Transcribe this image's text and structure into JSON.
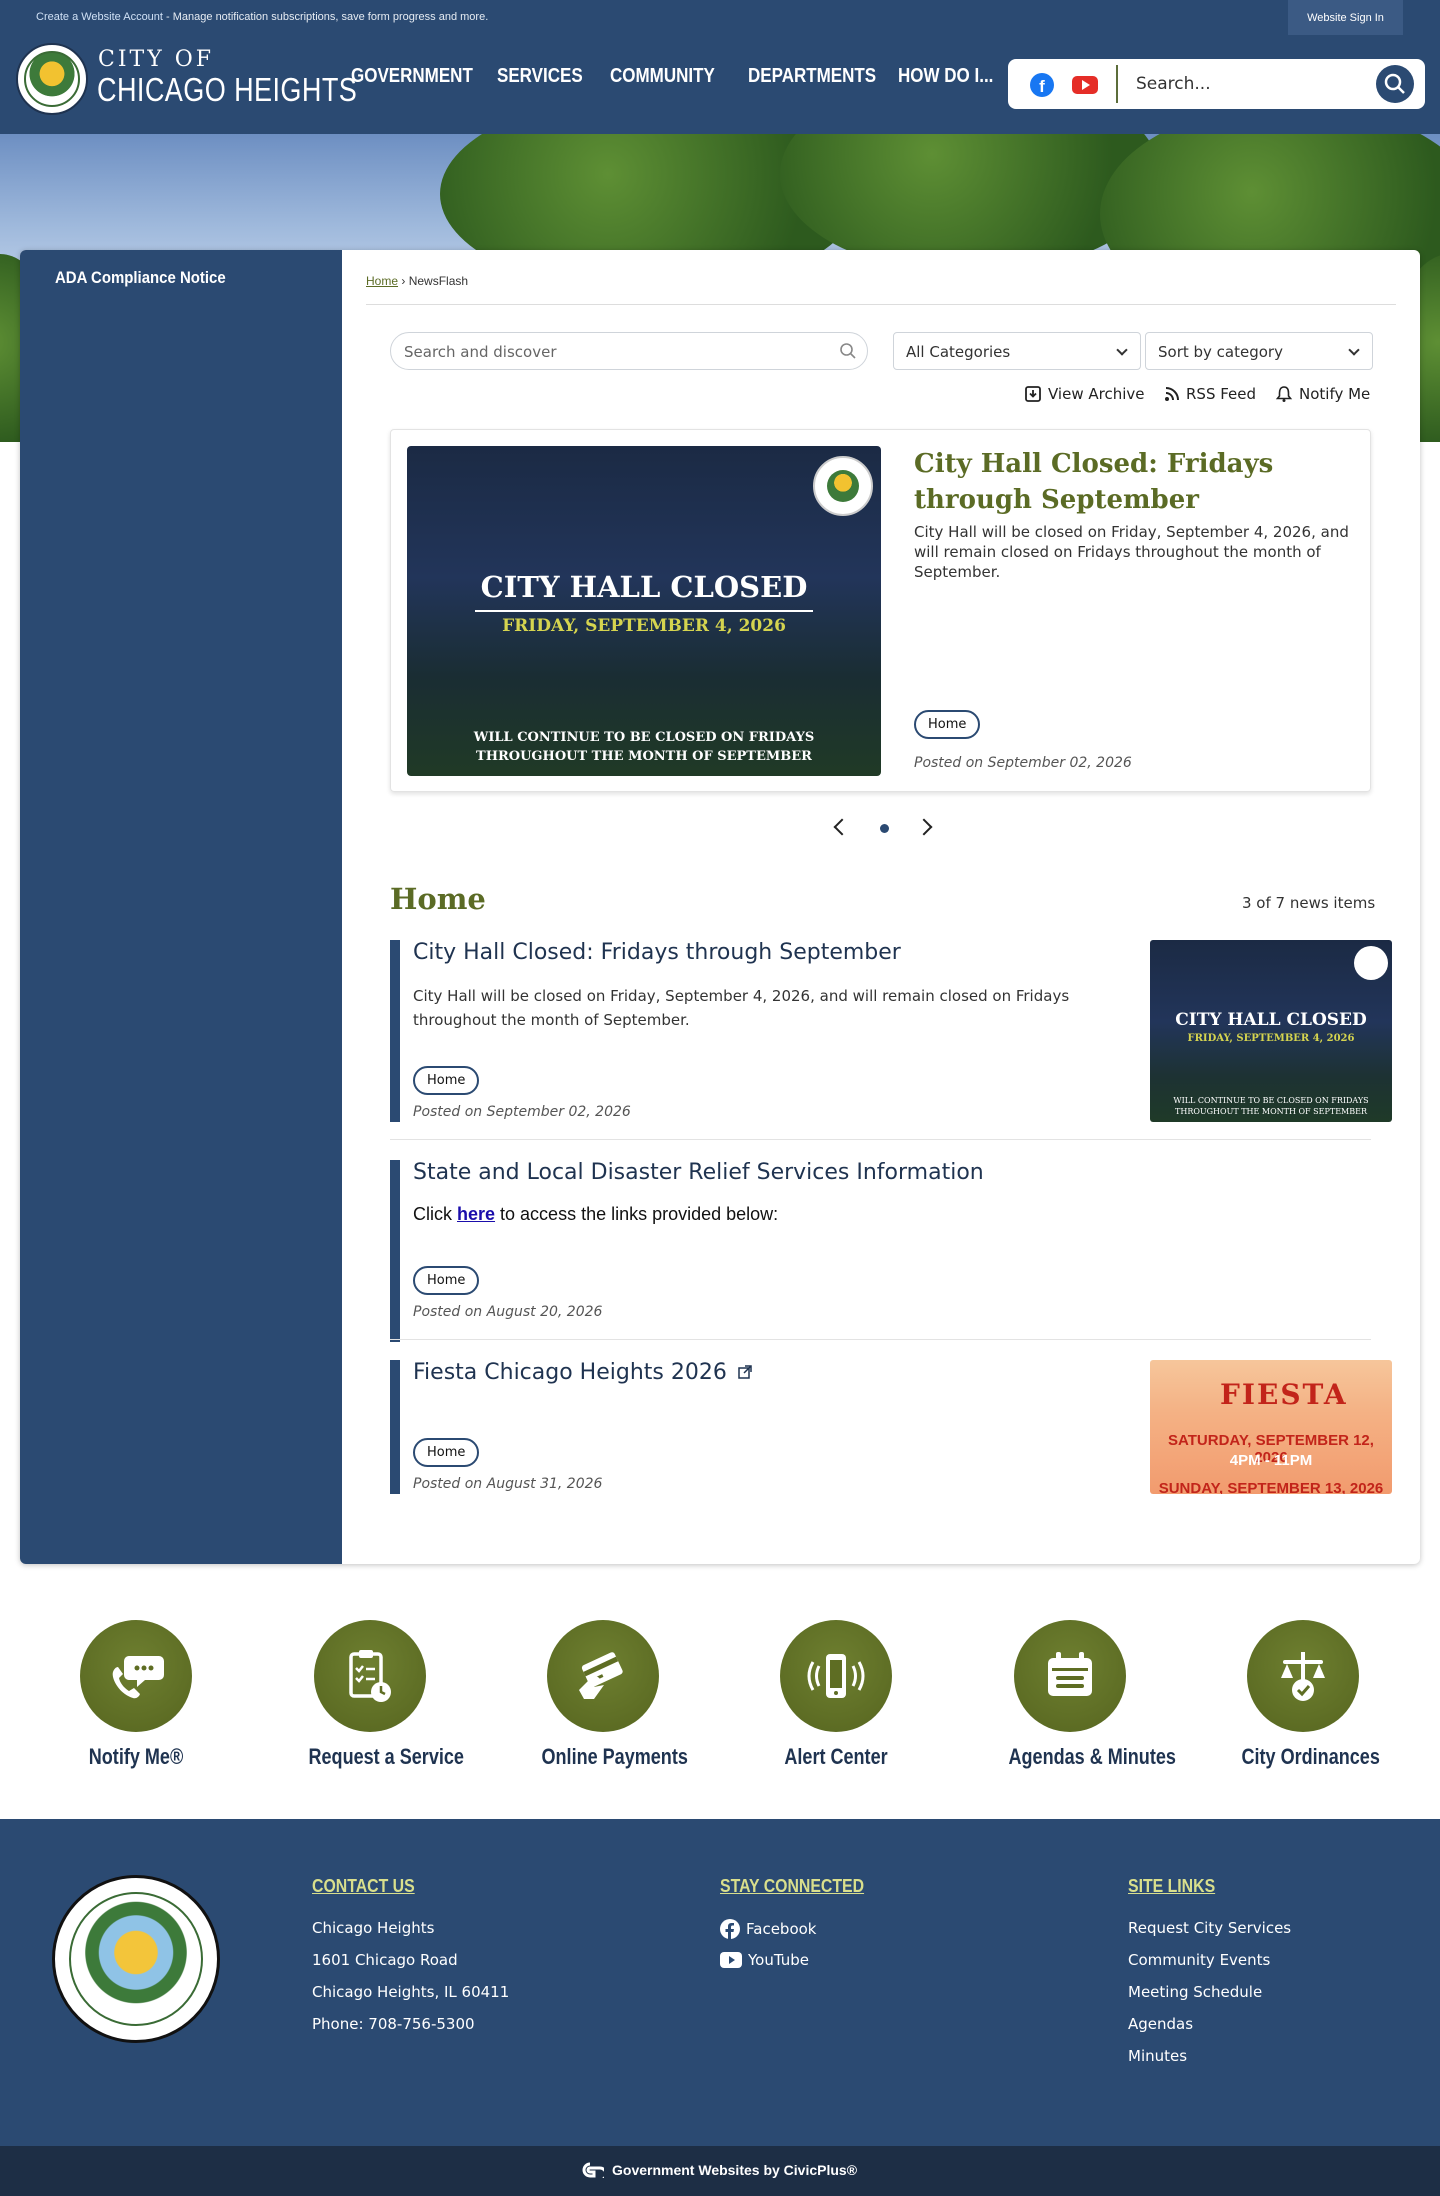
{
  "topbar": {
    "link": "Create a Website Account",
    "message": " - Manage notification subscriptions, save form progress and more.",
    "sign_in": "Website Sign In"
  },
  "header": {
    "logo_line1": "CITY OF",
    "logo_line2": "CHICAGO HEIGHTS",
    "nav": [
      "GOVERNMENT",
      "SERVICES",
      "COMMUNITY",
      "DEPARTMENTS",
      "HOW DO I..."
    ],
    "search_placeholder": "Search...",
    "icons": [
      "facebook-icon",
      "youtube-icon",
      "search-icon"
    ]
  },
  "sidebar": {
    "items": [
      {
        "label": "ADA Compliance Notice"
      }
    ]
  },
  "breadcrumb": {
    "home": "Home",
    "sep": " › ",
    "current": "NewsFlash"
  },
  "filters": {
    "search_placeholder": "Search and discover",
    "category": "All Categories",
    "sort": "Sort by category"
  },
  "tools": {
    "archive": "View Archive",
    "rss": "RSS Feed",
    "notify": "Notify Me"
  },
  "featured": {
    "image_title": "CITY HALL CLOSED",
    "image_date": "FRIDAY, SEPTEMBER 4, 2026",
    "image_foot1": "WILL CONTINUE TO BE CLOSED ON FRIDAYS",
    "image_foot2": "THROUGHOUT THE MONTH OF SEPTEMBER",
    "title": "City Hall Closed: Fridays through September",
    "description": "City Hall will be closed on Friday, September 4, 2026, and will remain closed on Fridays throughout the month of September.",
    "tag": "Home",
    "posted": "Posted on September 02, 2026"
  },
  "section": {
    "title": "Home",
    "count": "3 of 7 news items"
  },
  "items": [
    {
      "title": "City Hall Closed: Fridays through September",
      "description": "City Hall will be closed on Friday, September 4, 2026, and will remain closed on Fridays throughout the month of September.",
      "tag": "Home",
      "posted": "Posted on September 02, 2026",
      "thumb_title": "CITY HALL CLOSED",
      "thumb_date": "FRIDAY, SEPTEMBER 4, 2026",
      "thumb_foot1": "WILL CONTINUE TO BE CLOSED ON FRIDAYS",
      "thumb_foot2": "THROUGHOUT THE MONTH OF SEPTEMBER"
    },
    {
      "title": "State and Local Disaster Relief Services Information",
      "desc_pre": "Click ",
      "desc_link": "here",
      "desc_post": " to access the links provided below:",
      "tag": "Home",
      "posted": "Posted on August 20, 2026"
    },
    {
      "title": "Fiesta Chicago Heights 2026",
      "tag": "Home",
      "posted": "Posted on August 31, 2026",
      "thumb_title": "FIESTA",
      "thumb_line1": "SATURDAY, SEPTEMBER 12, 2026",
      "thumb_line2": "4PM - 11PM",
      "thumb_line3": "SUNDAY, SEPTEMBER 13, 2026"
    }
  ],
  "quick_links": [
    "Notify Me®",
    "Request a Service",
    "Online Payments",
    "Alert Center",
    "Agendas & Minutes",
    "City Ordinances"
  ],
  "footer": {
    "contact_head": "CONTACT US",
    "contact": [
      "Chicago Heights",
      "1601 Chicago Road",
      "Chicago Heights, IL 60411",
      "Phone: 708-756-5300"
    ],
    "stay_head": "STAY CONNECTED",
    "stay": [
      "Facebook",
      "YouTube"
    ],
    "site_head": "SITE LINKS",
    "site": [
      "Request City Services",
      "Community Events",
      "Meeting Schedule",
      "Agendas",
      "Minutes"
    ],
    "civic": "Government Websites by CivicPlus®"
  },
  "colors": {
    "navy": "#2b4a72",
    "olive": "#5b6b25",
    "olive_light": "#d9df8c"
  }
}
